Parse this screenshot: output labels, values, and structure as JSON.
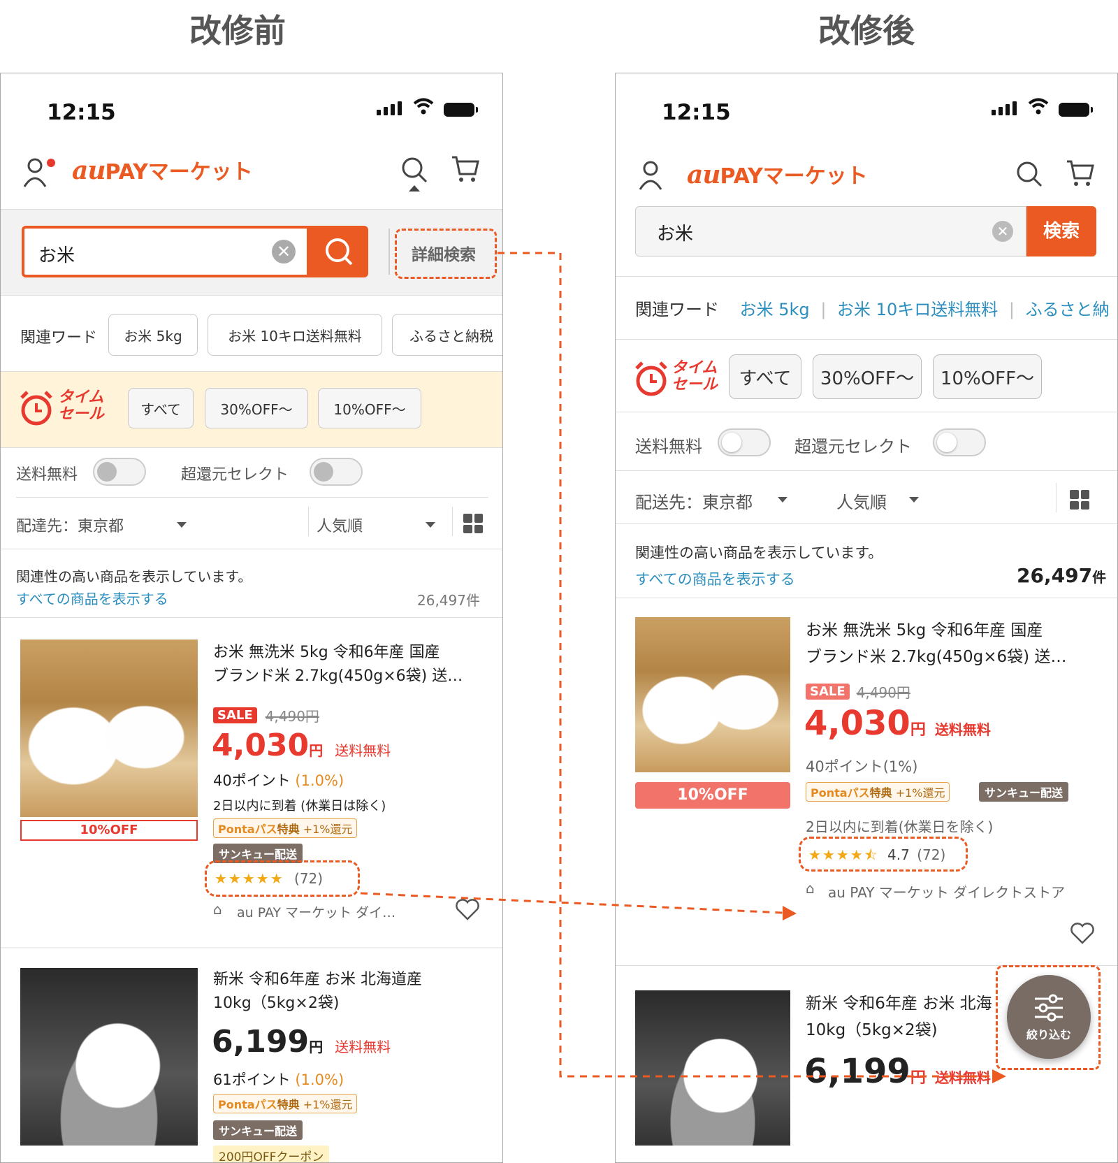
{
  "headings": {
    "before": "改修前",
    "after": "改修後"
  },
  "status": {
    "time": "12:15"
  },
  "logo": {
    "au": "au",
    "rest": "PAYマーケット"
  },
  "search": {
    "query": "お米",
    "button": "検索",
    "detail": "詳細検索"
  },
  "related": {
    "label": "関連ワード",
    "words": [
      "お米 5kg",
      "お米 10キロ送料無料",
      "ふるさと納税"
    ],
    "after_words": [
      "お米 5kg",
      "お米 10キロ送料無料",
      "ふるさと納"
    ]
  },
  "timesale": {
    "logo_line1": "タイム",
    "logo_line2": "セール",
    "chips": [
      "すべて",
      "30%OFF〜",
      "10%OFF〜"
    ]
  },
  "filters": {
    "free_shipping": "送料無料",
    "super_return": "超還元セレクト"
  },
  "sort": {
    "delivery_before": "配達先：東京都",
    "delivery_after": "配送先：東京都",
    "order": "人気順"
  },
  "info": {
    "note": "関連性の高い商品を表示しています。",
    "show_all": "すべての商品を表示する",
    "count_before": "26,497件",
    "count_num": "26,497",
    "count_unit": "件"
  },
  "product1": {
    "title_line1": "お米 無洗米 5kg 令和6年産 国産",
    "title_line2": "ブランド米 2.7kg(450g×6袋) 送…",
    "sale": "SALE",
    "orig_price": "4,490円",
    "price": "4,030",
    "yen": "円",
    "free": "送料無料",
    "points_before": "40ポイント",
    "points_rate_before": "(1.0%)",
    "points_after": "40ポイント(1%)",
    "delivery_before": "2日以内に到着 (休業日は除く)",
    "delivery_after": "2日以内に到着(休業日を除く)",
    "discount": "10%OFF",
    "ponta_a": "Ponta",
    "ponta_b": "パス",
    "ponta_c": "特典",
    "ponta_d": "+1%還元",
    "thanks": "サンキュー配送",
    "stars_before": "★★★★★",
    "stars_after": "★★★★⯪",
    "rating": 4.7,
    "rating_text": "4.7",
    "reviews": "(72)",
    "shop_before": "au PAY マーケット ダイ…",
    "shop_after": "au PAY マーケット ダイレクトストア"
  },
  "product2": {
    "title_line1": "新米 令和6年産 お米 北海道産",
    "title_line2": "10kg（5kg×2袋)",
    "after_line1": "新米 令和6年産 お米 北海",
    "price": "6,199",
    "yen": "円",
    "free": "送料無料",
    "points": "61ポイント",
    "points_rate": "(1.0%)",
    "thanks": "サンキュー配送",
    "coupon": "200円OFFクーポン"
  },
  "fab": {
    "label": "絞り込む"
  },
  "colors": {
    "accent": "#ea5a22",
    "price": "#e8392f",
    "link": "#2b8ebe"
  }
}
